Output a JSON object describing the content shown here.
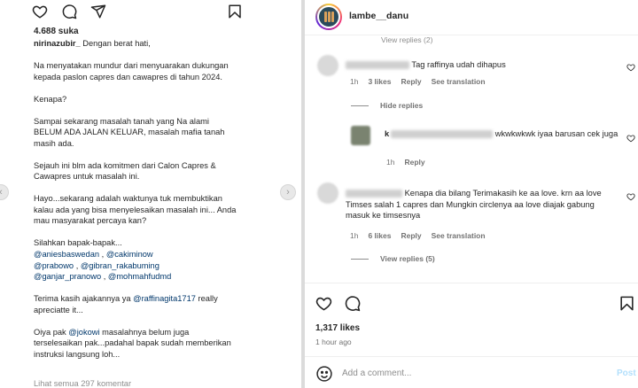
{
  "left": {
    "likes": "4.688 suka",
    "caption_user": "nirinazubir_",
    "caption_first": "Dengan berat hati,",
    "para1": "Na menyatakan mundur dari menyuarakan dukungan kepada paslon capres dan cawapres di tahun 2024.",
    "para2": "Kenapa?",
    "para3": "Sampai sekarang masalah tanah yang Na alami BELUM ADA JALAN KELUAR, masalah mafia tanah masih ada.",
    "para4": "Sejauh ini blm ada komitmen dari Calon Capres & Cawapres untuk masalah ini.",
    "para5": "Hayo...sekarang adalah waktunya tuk membuktikan kalau ada yang bisa menyelesaikan masalah ini... Anda mau masyarakat percaya kan?",
    "para6_intro": "Silahkan bapak-bapak...",
    "mentions": {
      "m1": "@aniesbaswedan",
      "sep1": " , ",
      "m2": "@cakiminow",
      "m3": "@prabowo",
      "sep2": " , ",
      "m4": "@gibran_rakabuming",
      "m5": "@ganjar_pranowo",
      "sep3": " , ",
      "m6": "@mohmahfudmd"
    },
    "para7_a": "Terima kasih ajakannya ya ",
    "para7_mention": "@raffinagita1717",
    "para7_b": " really apreciatte it...",
    "para8_a": "Oiya pak ",
    "para8_mention": "@jokowi",
    "para8_b": " masalahnya belum juga terselesaikan pak...padahal bapak sudah memberikan instruksi langsung loh...",
    "view_all": "Lihat semua 297 komentar"
  },
  "right": {
    "username": "lambe__danu",
    "top_fade": "View replies (2)",
    "comment1": {
      "text": "Tag raffinya udah dihapus",
      "time": "1h",
      "likes": "3 likes",
      "reply": "Reply",
      "translate": "See translation"
    },
    "hide_replies": "Hide replies",
    "reply1": {
      "name": "k",
      "text": "wkwkwkwk iyaa barusan cek juga",
      "time": "1h",
      "reply": "Reply"
    },
    "comment2": {
      "text": "Kenapa dia bilang Terimakasih ke aa love. krn aa love Timses salah 1 capres dan Mungkin circlenya aa love diajak gabung masuk ke timsesnya",
      "time": "1h",
      "likes": "6 likes",
      "reply": "Reply",
      "translate": "See translation"
    },
    "view_replies": "View replies (5)",
    "likes": "1,317 likes",
    "time_ago": "1 hour ago",
    "add_comment_placeholder": "Add a comment...",
    "post_label": "Post"
  }
}
